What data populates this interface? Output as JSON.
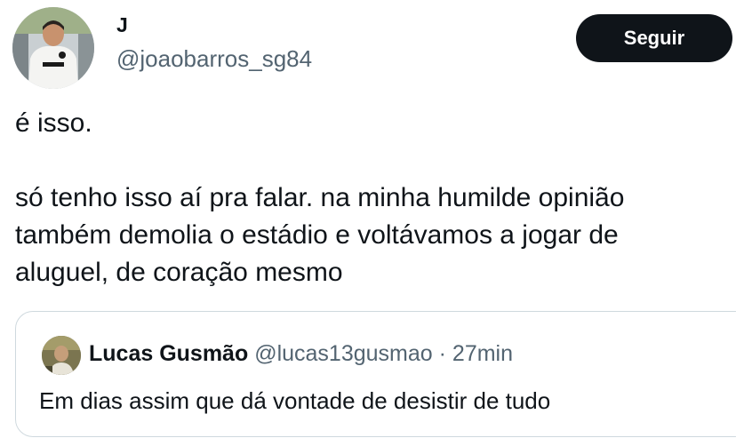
{
  "tweet": {
    "author": {
      "name": "J",
      "handle": "@joaobarros_sg84"
    },
    "follow_label": "Seguir",
    "text_lines": [
      "é isso.",
      "só tenho isso aí pra falar. na minha humilde opinião",
      "também demolia o estádio e voltávamos a jogar de",
      "aluguel, de coração mesmo"
    ]
  },
  "quote": {
    "author": {
      "name": "Lucas Gusmão",
      "handle": "@lucas13gusmao",
      "separator": "·",
      "time": "27min"
    },
    "text": "Em dias assim que dá vontade de desistir de tudo"
  },
  "colors": {
    "text_primary": "#0f1419",
    "text_secondary": "#536471",
    "button_bg": "#0f1419",
    "border": "#cfd9de"
  }
}
